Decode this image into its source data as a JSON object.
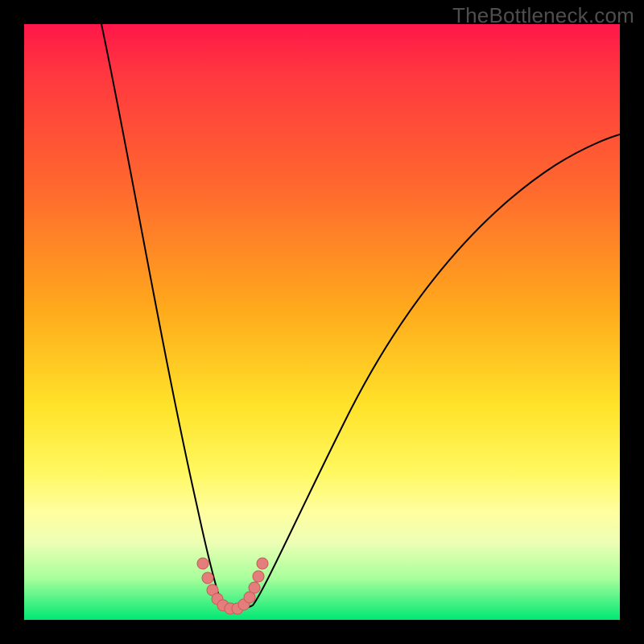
{
  "watermark": "TheBottleneck.com",
  "chart_data": {
    "type": "line",
    "title": "",
    "xlabel": "",
    "ylabel": "",
    "xlim": [
      0,
      100
    ],
    "ylim": [
      0,
      100
    ],
    "grid": false,
    "legend": false,
    "series": [
      {
        "name": "left-branch",
        "x": [
          13,
          15,
          17,
          19,
          21,
          23,
          25,
          27,
          29,
          30,
          31,
          32
        ],
        "y": [
          100,
          88,
          76,
          64,
          52,
          40,
          30,
          20,
          12,
          7,
          4,
          2
        ]
      },
      {
        "name": "right-branch",
        "x": [
          38,
          40,
          44,
          50,
          58,
          66,
          74,
          82,
          90,
          98,
          100
        ],
        "y": [
          2,
          5,
          14,
          28,
          42,
          54,
          63,
          70,
          76,
          80,
          81
        ]
      },
      {
        "name": "valley-floor",
        "x": [
          32,
          34,
          36,
          38
        ],
        "y": [
          2,
          1.5,
          1.5,
          2
        ]
      }
    ],
    "markers": {
      "name": "ideal-zone",
      "x": [
        30.0,
        30.7,
        31.5,
        32.3,
        33.3,
        34.5,
        35.7,
        36.8,
        37.8,
        38.6,
        39.3,
        40.0
      ],
      "y": [
        8.5,
        6.0,
        4.0,
        2.6,
        1.8,
        1.5,
        1.6,
        2.2,
        3.4,
        5.0,
        6.8,
        9.0
      ]
    },
    "gradient_bands": [
      {
        "label": "red",
        "y": 100
      },
      {
        "label": "orange",
        "y": 55
      },
      {
        "label": "yellow",
        "y": 25
      },
      {
        "label": "green",
        "y": 3
      }
    ]
  }
}
